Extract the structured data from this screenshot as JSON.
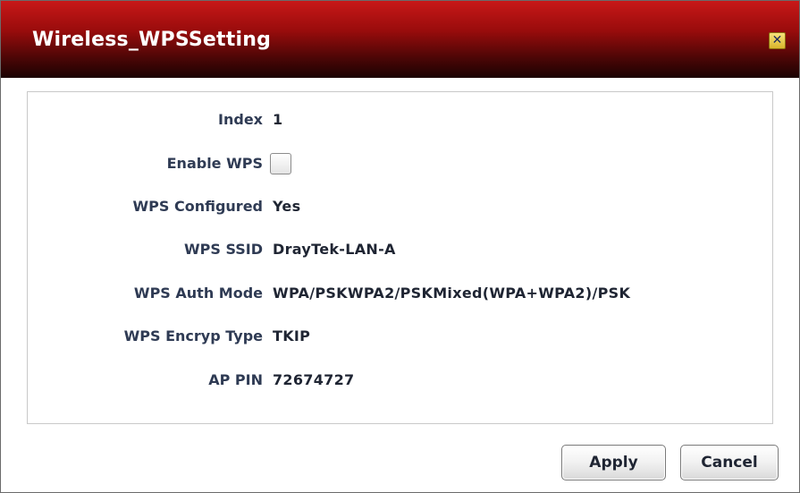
{
  "dialog": {
    "title": "Wireless_WPSSetting",
    "close_icon": "close-icon",
    "close_label": "✕"
  },
  "fields": [
    {
      "label": "Index",
      "value": "1"
    },
    {
      "label": "Enable WPS",
      "type": "checkbox",
      "checked": false
    },
    {
      "label": "WPS Configured",
      "value": "Yes"
    },
    {
      "label": "WPS SSID",
      "value": "DrayTek-LAN-A"
    },
    {
      "label": "WPS Auth Mode",
      "value": "WPA/PSKWPA2/PSKMixed(WPA+WPA2)/PSK"
    },
    {
      "label": "WPS Encryp Type",
      "value": "TKIP"
    },
    {
      "label": "AP PIN",
      "value": "72674727"
    }
  ],
  "buttons": {
    "apply": "Apply",
    "cancel": "Cancel"
  },
  "colors": {
    "titlebar_top": "#c81818",
    "titlebar_bottom": "#1a0202",
    "label_text": "#2f3b54",
    "close_button": "#e8c94a"
  }
}
